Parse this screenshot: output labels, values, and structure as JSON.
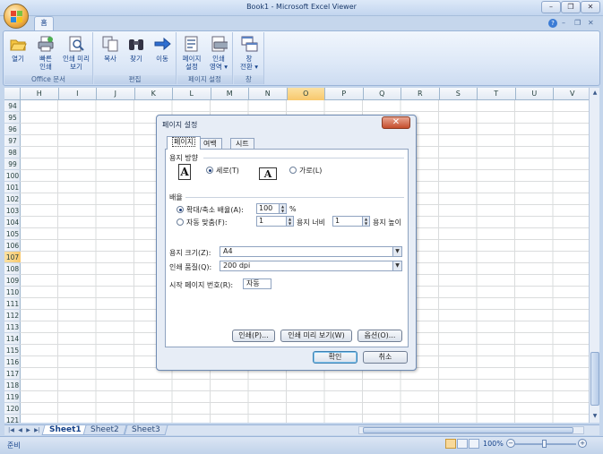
{
  "window": {
    "title": "Book1 - Microsoft Excel Viewer",
    "minimize": "–",
    "restore": "❐",
    "close": "✕"
  },
  "ribbon": {
    "tab_home": "홈",
    "help_icon": "?",
    "min": "–",
    "restore": "❐",
    "close": "✕",
    "groups": [
      {
        "label": "Office 문서",
        "buttons": [
          {
            "l1": "열기",
            "l2": ""
          },
          {
            "l1": "빠른",
            "l2": "인쇄"
          },
          {
            "l1": "인쇄 미리",
            "l2": "보기"
          }
        ]
      },
      {
        "label": "편집",
        "buttons": [
          {
            "l1": "복사",
            "l2": ""
          },
          {
            "l1": "찾기",
            "l2": ""
          },
          {
            "l1": "이동",
            "l2": ""
          }
        ]
      },
      {
        "label": "페이지 설정",
        "buttons": [
          {
            "l1": "페이지",
            "l2": "설정"
          },
          {
            "l1": "인쇄",
            "l2": "영역 ▾"
          }
        ]
      },
      {
        "label": "창",
        "buttons": [
          {
            "l1": "창",
            "l2": "전환 ▾"
          }
        ]
      }
    ]
  },
  "columns": [
    "H",
    "I",
    "J",
    "K",
    "L",
    "M",
    "N",
    "O",
    "P",
    "Q",
    "R",
    "S",
    "T",
    "U",
    "V"
  ],
  "selected_column": "O",
  "rows": [
    "94",
    "95",
    "96",
    "97",
    "98",
    "99",
    "100",
    "101",
    "102",
    "103",
    "104",
    "105",
    "106",
    "107",
    "108",
    "109",
    "110",
    "111",
    "112",
    "113",
    "114",
    "115",
    "116",
    "117",
    "118",
    "119",
    "120",
    "121"
  ],
  "selected_row": "107",
  "sheets": [
    "Sheet1",
    "Sheet2",
    "Sheet3"
  ],
  "active_sheet": "Sheet1",
  "status": {
    "ready": "준비",
    "zoom": "100%",
    "zoom_out": "−",
    "zoom_in": "+"
  },
  "dialog": {
    "title": "페이지 설정",
    "close": "✕",
    "tabs": [
      "페이지",
      "여백",
      "시트"
    ],
    "active_tab": "페이지",
    "orientation_label": "용지 방향",
    "portrait_label": "세로(T)",
    "landscape_label": "가로(L)",
    "portrait_selected": true,
    "scaling_label": "배율",
    "adjust_label": "확대/축소 배율(A):",
    "adjust_value": "100",
    "adjust_unit": "%",
    "fit_label": "자동 맞춤(F):",
    "fit_wide_value": "1",
    "fit_wide_label": "용지 너비",
    "fit_tall_value": "1",
    "fit_tall_label": "용지 높이",
    "paper_size_label": "용지 크기(Z):",
    "paper_size_value": "A4",
    "print_quality_label": "인쇄 품질(Q):",
    "print_quality_value": "200 dpi",
    "first_page_label": "시작 페이지 번호(R):",
    "first_page_value": "자동",
    "print_button": "인쇄(P)...",
    "preview_button": "인쇄 미리 보기(W)",
    "options_button": "옵션(O)...",
    "ok_button": "확인",
    "cancel_button": "취소"
  },
  "colors": {
    "accent": "#15428b",
    "selected_header": "#f8c86c",
    "close_red": "#c44d2c"
  }
}
